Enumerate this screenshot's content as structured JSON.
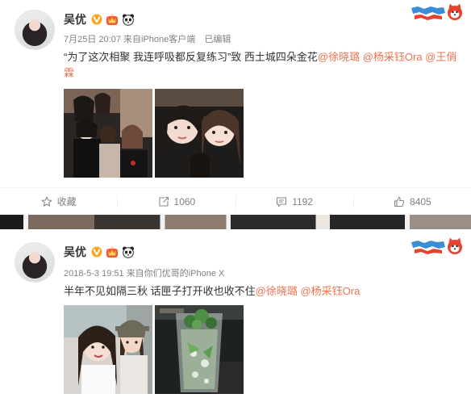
{
  "posts": [
    {
      "author": "吴优",
      "date": "7月25日 20:07",
      "source": "来自iPhone客户端",
      "edited": "已编辑",
      "text_prefix": "“为了这次相聚 我连呼吸都反复练习”致 西土城四朵金花",
      "mentions": [
        "@徐晓璐",
        "@杨采钰Ora",
        "@王俏霖"
      ],
      "mention_separator": " ",
      "actions": {
        "favorite": "收藏",
        "repost": "1060",
        "comment": "1192",
        "like": "8405"
      }
    },
    {
      "author": "吴优",
      "date": "2018-5-3 19:51",
      "source": "来自你们优哥的iPhone X",
      "text_prefix": "半年不见如隔三秋 话匣子打开收也收不住",
      "mentions": [
        "@徐晓璐",
        "@杨采钰Ora"
      ],
      "mention_separator": " "
    }
  ],
  "icons": {
    "verified": "verified-v-icon",
    "crown": "crown-badge-icon",
    "panda": "panda-badge-icon",
    "logo": "cartoon-fox-logo",
    "favorite": "star-icon",
    "repost": "repost-icon",
    "comment": "comment-icon",
    "like": "thumbs-up-icon"
  },
  "colors": {
    "mention": "#eb7350",
    "verified": "#f5a623",
    "muted": "#808080",
    "text": "#333333"
  }
}
